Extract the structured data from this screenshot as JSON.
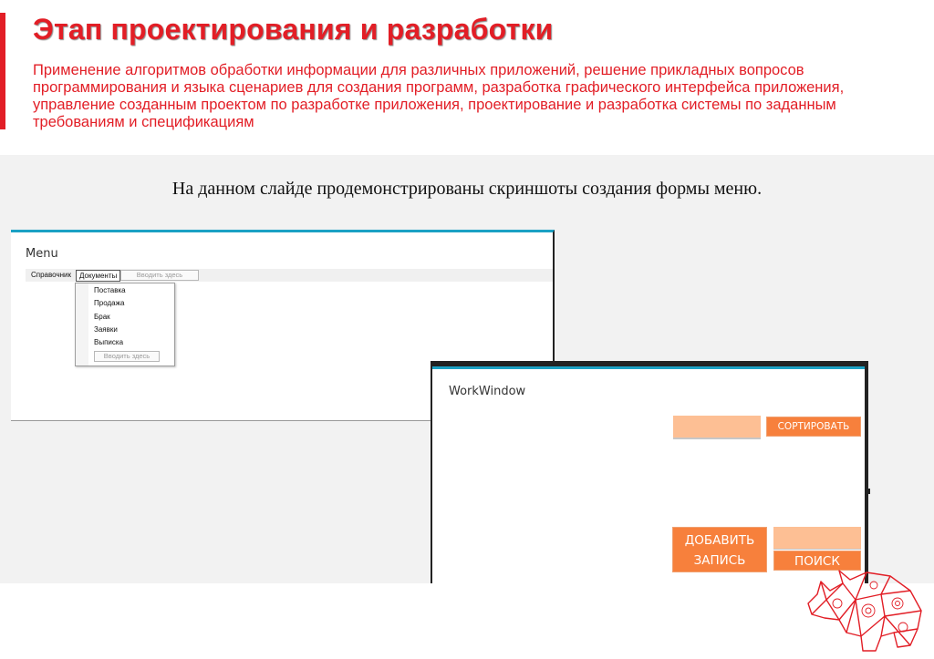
{
  "slide": {
    "title": "Этап проектирования и разработки",
    "subtitle": "Применение алгоритмов обработки информации для различных приложений, решение прикладных вопросов программирования и языка сценариев для создания программ, разработка графического интерфейса приложения, управление созданным проектом по разработке приложения, проектирование и разработка системы по заданным требованиям и спецификациям",
    "caption": "На данном слайде продемонстрированы скриншоты создания формы меню.",
    "accent_color": "#e21e26"
  },
  "menu_window": {
    "title": "Menu",
    "menubar": {
      "item_1": "Справочник",
      "item_2": "Документы",
      "type_here": "Вводить здесь"
    },
    "dropdown": {
      "items": [
        "Поставка",
        "Продажа",
        "Брак",
        "Заявки",
        "Выписка"
      ],
      "type_here": "Вводить здесь"
    }
  },
  "work_window": {
    "title": "WorkWindow",
    "sort_button": "СОРТИРОВАТЬ",
    "add_button_line1": "ДОБАВИТЬ",
    "add_button_line2": "ЗАПИСЬ",
    "search_button": "ПОИСК",
    "field_color": "#fdbf94",
    "button_color": "#f7803c",
    "window_accent": "#1ba1c4"
  },
  "logo": {
    "icon": "rhino-logo-icon"
  }
}
